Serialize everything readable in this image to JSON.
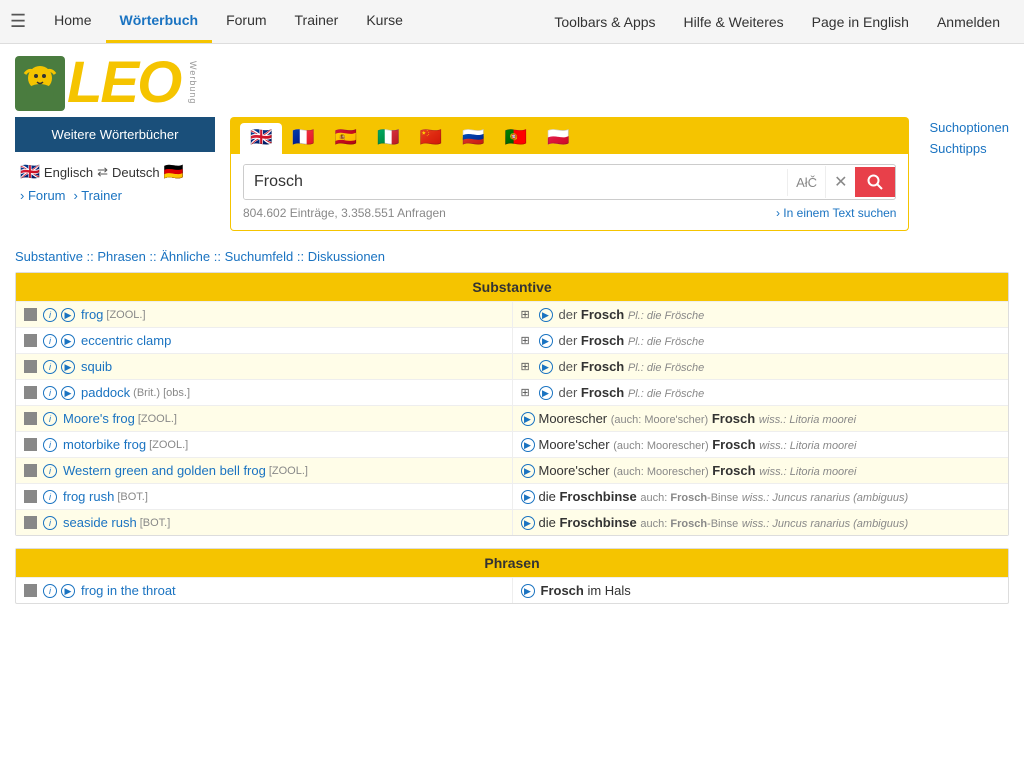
{
  "nav": {
    "hamburger": "☰",
    "links": [
      {
        "label": "Home",
        "active": false
      },
      {
        "label": "Wörterbuch",
        "active": true
      },
      {
        "label": "Forum",
        "active": false
      },
      {
        "label": "Trainer",
        "active": false
      },
      {
        "label": "Kurse",
        "active": false
      }
    ],
    "right_links": [
      {
        "label": "Toolbars & Apps"
      },
      {
        "label": "Hilfe & Weiteres"
      },
      {
        "label": "Page in English"
      },
      {
        "label": "Anmelden"
      }
    ]
  },
  "logo": {
    "text": "LEO",
    "werbung": "Werbung"
  },
  "sidebar": {
    "dict_btn": "Weitere Wörterbücher",
    "lang_from": "Englisch",
    "lang_arrow": "⇄",
    "lang_to": "Deutsch",
    "forum_label": "› Forum",
    "trainer_label": "› Trainer"
  },
  "search": {
    "query": "Frosch",
    "atc_label": "AłČ",
    "clear_icon": "✕",
    "entries_count": "804.602 Einträge, 3.358.551 Anfragen",
    "in_text": "› In einem Text suchen",
    "options_label": "Suchoptionen",
    "tips_label": "Suchtipps"
  },
  "flags": [
    "🇬🇧",
    "🇫🇷",
    "🇪🇸",
    "🇮🇹",
    "🇨🇳",
    "🇷🇺",
    "🇵🇹",
    "🇵🇱"
  ],
  "breadcrumb": {
    "items": [
      "Substantive",
      "Phrasen",
      "Ähnliche",
      "Suchumfeld",
      "Diskussionen"
    ],
    "separator": " :: "
  },
  "sections": [
    {
      "title": "Substantive",
      "rows": [
        {
          "en_icons": [
            "save",
            "info",
            "play"
          ],
          "de_icons": [
            "grid",
            "play"
          ],
          "en_text": "frog",
          "en_tag": "[ZOOL.]",
          "de_article": "der",
          "de_word": "Frosch",
          "de_extra": "Pl.: die Frösche",
          "alt": true
        },
        {
          "en_icons": [
            "save",
            "info",
            "play"
          ],
          "de_icons": [
            "grid",
            "play"
          ],
          "en_text": "eccentric clamp",
          "en_tag": "",
          "de_article": "der",
          "de_word": "Frosch",
          "de_extra": "Pl.: die Frösche",
          "alt": false
        },
        {
          "en_icons": [
            "save",
            "info",
            "play"
          ],
          "de_icons": [
            "grid",
            "play"
          ],
          "en_text": "squib",
          "en_tag": "",
          "de_article": "der",
          "de_word": "Frosch",
          "de_extra": "Pl.: die Frösche",
          "alt": true
        },
        {
          "en_icons": [
            "save",
            "info",
            "play"
          ],
          "de_icons": [
            "grid",
            "play"
          ],
          "en_text": "paddock",
          "en_tag": "(Brit.) [obs.]",
          "de_article": "der",
          "de_word": "Frosch",
          "de_extra": "Pl.: die Frösche",
          "alt": false
        },
        {
          "en_icons": [
            "save",
            "info"
          ],
          "de_icons": [
            "play2"
          ],
          "en_text": "Moore's frog",
          "en_tag": "[ZOOL.]",
          "de_text": "Moorescher (auch: Moore'scher) Frosch",
          "de_wiss": "wiss.: Litoria moorei",
          "alt": true
        },
        {
          "en_icons": [
            "save",
            "info"
          ],
          "de_icons": [
            "play2"
          ],
          "en_text": "motorbike frog",
          "en_tag": "[ZOOL.]",
          "de_text": "Moore'scher (auch: Moorescher) Frosch",
          "de_wiss": "wiss.: Litoria moorei",
          "alt": false
        },
        {
          "en_icons": [
            "save",
            "info"
          ],
          "de_icons": [
            "play2"
          ],
          "en_text": "Western green and golden bell frog",
          "en_tag": "[ZOOL.]",
          "de_text": "Moore'scher (auch: Moorescher) Frosch",
          "de_wiss": "wiss.: Litoria moorei",
          "alt": true
        },
        {
          "en_icons": [
            "save",
            "info"
          ],
          "de_icons": [
            "play2"
          ],
          "en_text": "frog rush",
          "en_tag": "[BOT.]",
          "de_text": "die Froschbinse",
          "de_also": "auch: Frosch-Binse",
          "de_wiss": "wiss.: Juncus ranarius (ambiguus)",
          "alt": false
        },
        {
          "en_icons": [
            "save",
            "info"
          ],
          "de_icons": [
            "play2"
          ],
          "en_text": "seaside rush",
          "en_tag": "[BOT.]",
          "de_text": "die Froschbinse",
          "de_also": "auch: Frosch-Binse",
          "de_wiss": "wiss.: Juncus ranarius (ambiguus)",
          "alt": true
        }
      ]
    },
    {
      "title": "Phrasen",
      "rows": [
        {
          "en_icons": [
            "save",
            "info",
            "play"
          ],
          "de_icons": [
            "play2"
          ],
          "en_text": "frog in the throat",
          "en_tag": "",
          "de_text": "Frosch im Hals",
          "de_bold": "Frosch",
          "alt": false
        }
      ]
    }
  ]
}
